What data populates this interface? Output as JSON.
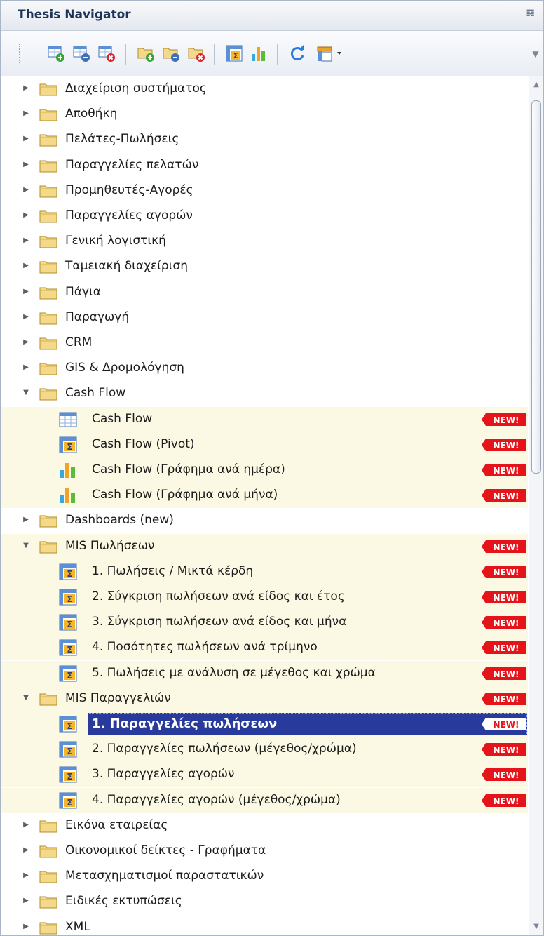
{
  "panel": {
    "title": "Thesis Navigator"
  },
  "toolbar": {
    "icons": [
      "add-item-icon",
      "edit-item-icon",
      "delete-item-icon",
      "add-folder-icon",
      "edit-folder-icon",
      "delete-folder-icon",
      "pivot-icon",
      "chart-icon",
      "refresh-icon",
      "customize-dropdown-icon"
    ]
  },
  "badge_text": "NEW!",
  "colors": {
    "highlight": "#fbf9e3",
    "selection": "#283a9b",
    "badge": "#e5141b",
    "folder": "#f4d98a"
  },
  "tree": [
    {
      "label": "Διαχείριση συστήματος",
      "level": 0,
      "kind": "folder",
      "state": "collapsed"
    },
    {
      "label": "Αποθήκη",
      "level": 0,
      "kind": "folder",
      "state": "collapsed"
    },
    {
      "label": "Πελάτες-Πωλήσεις",
      "level": 0,
      "kind": "folder",
      "state": "collapsed"
    },
    {
      "label": "Παραγγελίες πελατών",
      "level": 0,
      "kind": "folder",
      "state": "collapsed"
    },
    {
      "label": "Προμηθευτές-Αγορές",
      "level": 0,
      "kind": "folder",
      "state": "collapsed"
    },
    {
      "label": "Παραγγελίες αγορών",
      "level": 0,
      "kind": "folder",
      "state": "collapsed"
    },
    {
      "label": "Γενική λογιστική",
      "level": 0,
      "kind": "folder",
      "state": "collapsed"
    },
    {
      "label": "Ταμειακή διαχείριση",
      "level": 0,
      "kind": "folder",
      "state": "collapsed"
    },
    {
      "label": "Πάγια",
      "level": 0,
      "kind": "folder",
      "state": "collapsed"
    },
    {
      "label": "Παραγωγή",
      "level": 0,
      "kind": "folder",
      "state": "collapsed"
    },
    {
      "label": "CRM",
      "level": 0,
      "kind": "folder",
      "state": "collapsed"
    },
    {
      "label": "GIS & Δρομολόγηση",
      "level": 0,
      "kind": "folder",
      "state": "collapsed"
    },
    {
      "label": "Cash Flow",
      "level": 0,
      "kind": "folder",
      "state": "expanded"
    },
    {
      "label": "Cash Flow",
      "level": 1,
      "kind": "table",
      "is_new": true
    },
    {
      "label": "Cash Flow (Pivot)",
      "level": 1,
      "kind": "pivot",
      "is_new": true
    },
    {
      "label": "Cash Flow (Γράφημα ανά ημέρα)",
      "level": 1,
      "kind": "chart",
      "is_new": true
    },
    {
      "label": "Cash Flow (Γράφημα ανά μήνα)",
      "level": 1,
      "kind": "chart",
      "is_new": true
    },
    {
      "label": "Dashboards (new)",
      "level": 0,
      "kind": "folder",
      "state": "collapsed"
    },
    {
      "label": "MIS Πωλήσεων",
      "level": 0,
      "kind": "folder",
      "state": "expanded",
      "is_new": true
    },
    {
      "label": "1. Πωλήσεις / Μικτά κέρδη",
      "level": 1,
      "kind": "pivot",
      "is_new": true
    },
    {
      "label": "2. Σύγκριση πωλήσεων ανά είδος και έτος",
      "level": 1,
      "kind": "pivot",
      "is_new": true
    },
    {
      "label": "3. Σύγκριση πωλήσεων ανά είδος και μήνα",
      "level": 1,
      "kind": "pivot",
      "is_new": true
    },
    {
      "label": "4. Ποσότητες πωλήσεων ανά τρίμηνο",
      "level": 1,
      "kind": "pivot",
      "is_new": true
    },
    {
      "label": "5. Πωλήσεις με ανάλυση σε μέγεθος και χρώμα",
      "level": 1,
      "kind": "pivot",
      "is_new": true
    },
    {
      "label": "MIS Παραγγελιών",
      "level": 0,
      "kind": "folder",
      "state": "expanded",
      "is_new": true
    },
    {
      "label": "1. Παραγγελίες πωλήσεων",
      "level": 1,
      "kind": "pivot",
      "is_new": true,
      "selected": true
    },
    {
      "label": "2. Παραγγελίες πωλήσεων (μέγεθος/χρώμα)",
      "level": 1,
      "kind": "pivot",
      "is_new": true
    },
    {
      "label": "3. Παραγγελίες αγορών",
      "level": 1,
      "kind": "pivot",
      "is_new": true
    },
    {
      "label": "4. Παραγγελίες αγορών (μέγεθος/χρώμα)",
      "level": 1,
      "kind": "pivot",
      "is_new": true
    },
    {
      "label": "Εικόνα εταιρείας",
      "level": 0,
      "kind": "folder",
      "state": "collapsed"
    },
    {
      "label": "Οικονομικοί δείκτες - Γραφήματα",
      "level": 0,
      "kind": "folder",
      "state": "collapsed"
    },
    {
      "label": "Μετασχηματισμοί παραστατικών",
      "level": 0,
      "kind": "folder",
      "state": "collapsed"
    },
    {
      "label": "Ειδικές εκτυπώσεις",
      "level": 0,
      "kind": "folder",
      "state": "collapsed"
    },
    {
      "label": "XML",
      "level": 0,
      "kind": "folder",
      "state": "collapsed"
    }
  ]
}
